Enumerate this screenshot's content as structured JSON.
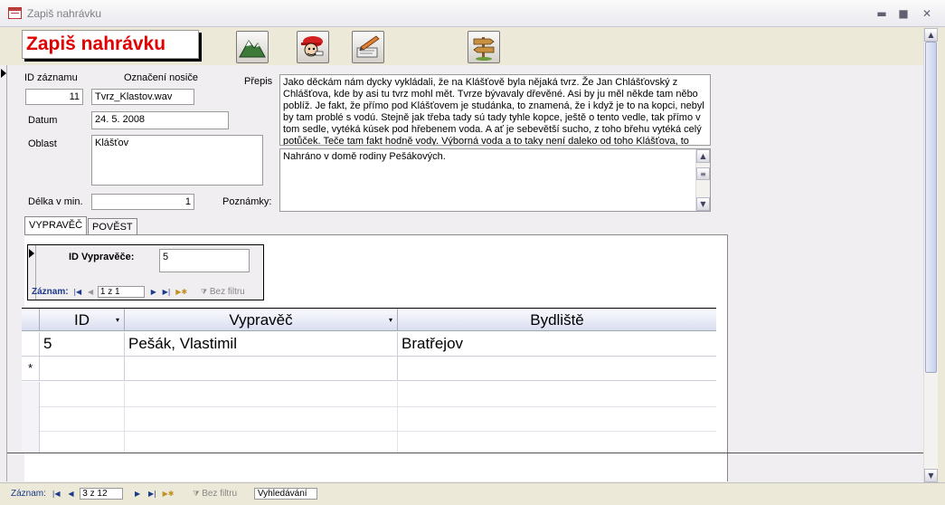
{
  "window": {
    "title": "Zapiš nahrávku",
    "minimize": "▬",
    "maximize": "■",
    "close": "✕"
  },
  "header": {
    "form_title": "Zapiš nahrávku",
    "buttons": [
      {
        "name": "mountain-icon"
      },
      {
        "name": "character-icon"
      },
      {
        "name": "edit-pencil-icon"
      },
      {
        "name": "signpost-icon"
      }
    ]
  },
  "record": {
    "id_label": "ID záznamu",
    "id_value": "11",
    "carrier_label": "Označení nosiče",
    "carrier_value": "Tvrz_Klastov.wav",
    "date_label": "Datum",
    "date_value": "24. 5. 2008",
    "area_label": "Oblast",
    "area_value": "Klášťov",
    "length_label": "Délka v min.",
    "length_value": "1",
    "transcript_label": "Přepis",
    "transcript_value": "Jako děckám nám dycky vykládali, že na Klášťově byla nějaká tvrz. Že Jan Chlášťovský z Chlášťova, kde by asi tu tvrz mohl mět. Tvrze bývavaly dřevěné. Asi by ju měl někde tam něbo poblíž. Je fakt, že přímo pod Klášťovem je studánka, to znamená, že i když je to na kopci, nebyl by tam problé s vodú. Stejně jak třeba tady sú tady tyhle kopce, ještě o tento vedle, tak přímo v tom sedle, vytéká kúsek pod hřebenem voda. A ať je sebevětší sucho, z toho břehu vytéká celý potůček. Teče tam fakt hodně vody. Výborná voda a to taky není daleko od toho Klášťova, to",
    "notes_label": "Poznámky:",
    "notes_value": "Nahráno v domě rodiny Pešákových."
  },
  "tabs": [
    {
      "label": "VYPRAVĚČ",
      "active": true
    },
    {
      "label": "POVĚST",
      "active": false
    }
  ],
  "narrator_subform": {
    "id_label": "ID Vypravěče:",
    "id_value": "5",
    "nav": {
      "label": "Záznam:",
      "position": "1 z 1",
      "filter": "Bez filtru"
    }
  },
  "grid": {
    "columns": [
      "ID",
      "Vypravěč",
      "Bydliště"
    ],
    "rows": [
      {
        "id": "5",
        "narrator": "Pešák, Vlastimil",
        "residence": "Bratřejov"
      }
    ],
    "new_row_marker": "*"
  },
  "bottom_nav": {
    "label": "Záznam:",
    "position": "3 z 12",
    "filter": "Bez filtru",
    "search": "Vyhledávání"
  }
}
